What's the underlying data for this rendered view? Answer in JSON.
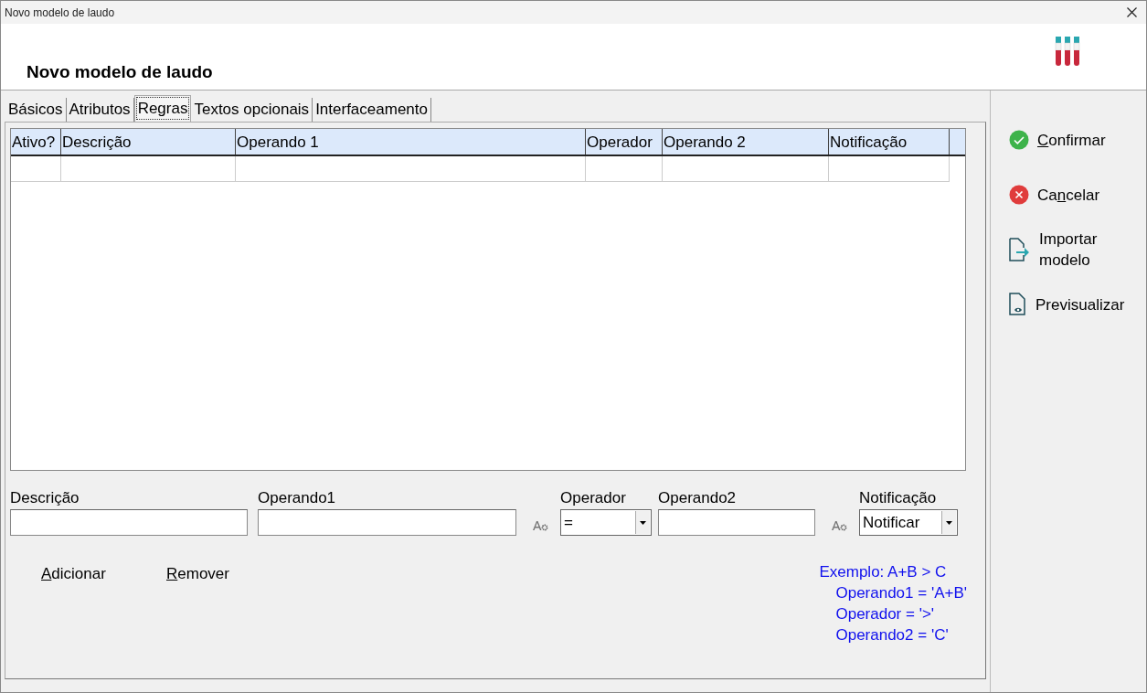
{
  "window": {
    "title": "Novo modelo de laudo"
  },
  "header": {
    "title": "Novo modelo de laudo"
  },
  "tabs": [
    {
      "label": "Básicos",
      "selected": false
    },
    {
      "label": "Atributos",
      "selected": false
    },
    {
      "label": "Regras",
      "selected": true
    },
    {
      "label": "Textos opcionais",
      "selected": false
    },
    {
      "label": "Interfaceamento",
      "selected": false
    }
  ],
  "table": {
    "columns": [
      "Ativo?",
      "Descrição",
      "Operando 1",
      "Operador",
      "Operando 2",
      "Notificação"
    ]
  },
  "form": {
    "fields": [
      {
        "kind": "text",
        "label": "Descrição",
        "expr": false
      },
      {
        "kind": "text",
        "label": "Operando1",
        "expr": true
      },
      {
        "kind": "select",
        "label": "Operador",
        "value": "="
      },
      {
        "kind": "text",
        "label": "Operando2",
        "expr": true
      },
      {
        "kind": "select",
        "label": "Notificação",
        "value": "Notificar"
      }
    ]
  },
  "row_buttons": [
    {
      "key": "A",
      "post": "dicionar"
    },
    {
      "key": "R",
      "post": "emover"
    }
  ],
  "example": [
    "Exemplo: A+B > C",
    "Operando1 = 'A+B'",
    "Operador = '>'",
    "Operando2 = 'C'"
  ],
  "actions": [
    {
      "kind": "confirm",
      "key": "C",
      "post": "onfirmar"
    },
    {
      "kind": "cancel",
      "pre": "Ca",
      "key": "n",
      "post": "celar"
    },
    {
      "kind": "import",
      "pre": "Importar modelo"
    },
    {
      "kind": "preview",
      "pre": "Previsualizar"
    }
  ]
}
